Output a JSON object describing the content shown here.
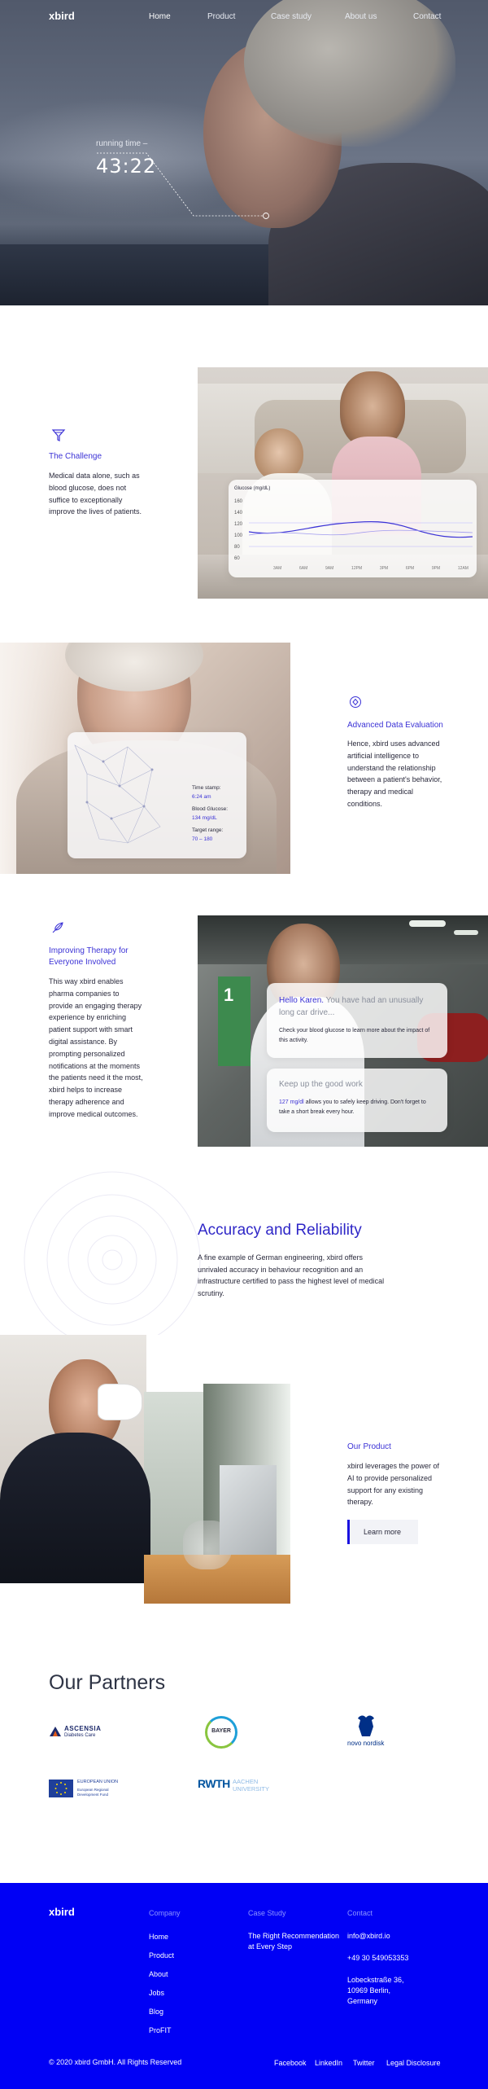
{
  "brand": {
    "logo": "xbird"
  },
  "nav": {
    "items": [
      "Home",
      "Product",
      "Case study",
      "About us",
      "Contact"
    ]
  },
  "hero": {
    "timer_label": "running time –",
    "timer_value": "43:22"
  },
  "challenge": {
    "title": "The Challenge",
    "body": "Medical data alone, such as blood glucose, does not suffice to exceptionally improve the lives of patients.",
    "chart": {
      "label": "Glucose (mg/dL)",
      "y_ticks": [
        "160",
        "140",
        "120",
        "100",
        "80",
        "60"
      ],
      "x_ticks": [
        "3AM",
        "6AM",
        "9AM",
        "12PM",
        "3PM",
        "6PM",
        "9PM",
        "12AM"
      ]
    }
  },
  "evaluation": {
    "title": "Advanced Data Evaluation",
    "body": "Hence, xbird uses advanced artificial intelligence to understand the relationship between a patient's behavior, therapy and medical conditions.",
    "card": {
      "time_label": "Time stamp:",
      "time_value": "6:24 am",
      "glucose_label": "Blood Glucose:",
      "glucose_value": "134 mg/dL",
      "target_label": "Target range:",
      "target_value": "70 – 180"
    }
  },
  "therapy": {
    "title": "Improving Therapy for Everyone Involved",
    "body": "This way xbird enables pharma companies to provide an engaging therapy experience by enriching patient support with smart digital assistance. By prompting personalized notifications at the moments the patients need it the most, xbird helps to increase therapy adherence and improve medical outcomes.",
    "card1": {
      "greeting": "Hello Karen.",
      "headline": "You have had an unusually long car drive...",
      "text": "Check your blood glucose to learn more about the impact of this activity."
    },
    "card2": {
      "headline": "Keep up the good work",
      "value": "127 mg/dl",
      "text_rest": "allows you to safely keep driving. Don't forget to take a short break every hour."
    }
  },
  "accuracy": {
    "title": "Accuracy and Reliability",
    "body": "A fine example of German engineering, xbird offers unrivaled accuracy in behaviour recognition and an infrastructure certified to pass the highest level of medical scrutiny."
  },
  "product": {
    "title": "Our Product",
    "body": "xbird leverages the power of AI to provide personalized support for any existing therapy.",
    "button": "Learn more"
  },
  "partners": {
    "title": "Our Partners",
    "logos": {
      "ascensia_name": "ASCENSIA",
      "ascensia_sub": "Diabetes Care",
      "bayer": "BAYER",
      "novo": "novo nordisk",
      "eu_top": "EUROPEAN UNION",
      "eu_sub": "European Regional Development Fund",
      "rwth": "RWTH",
      "rwth_sub": "AACHEN UNIVERSITY"
    }
  },
  "footer": {
    "logo": "xbird",
    "company_head": "Company",
    "company_links": [
      "Home",
      "Product",
      "About",
      "Jobs",
      "Blog",
      "ProFIT"
    ],
    "case_head": "Case Study",
    "case_text": "The Right Recommendation at Every Step",
    "contact_head": "Contact",
    "email": "info@xbird.io",
    "phone": "+49 30 549053353",
    "address_line1": "Lobeckstraße 36,",
    "address_line2": "10969 Berlin,",
    "address_line3": "Germany",
    "copyright": "© 2020 xbird GmbH. All Rights Reserved",
    "social": [
      "Facebook",
      "LinkedIn",
      "Twitter",
      "Legal Disclosure"
    ]
  },
  "colors": {
    "accent": "#3c33d6",
    "footer_bg": "#0000f5"
  }
}
